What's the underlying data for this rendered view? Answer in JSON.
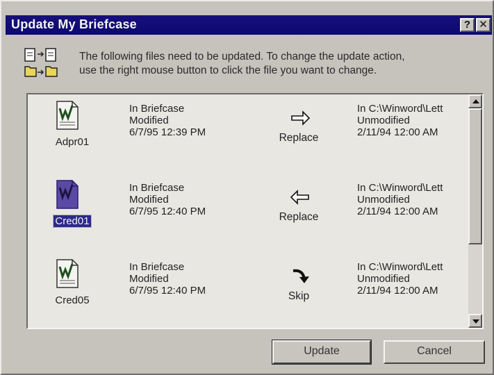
{
  "window": {
    "title": "Update My Briefcase",
    "help_label": "?",
    "close_label": "✕"
  },
  "instructions": {
    "line1": "The following files need to be updated. To change the update action,",
    "line2": "use the right mouse button to click the file you want to change."
  },
  "files": [
    {
      "name": "Adpr01",
      "briefcase": [
        "In Briefcase",
        "Modified",
        "6/7/95 12:39 PM"
      ],
      "action": "Replace",
      "action_icon": "arrow-right-icon",
      "destination": [
        "In C:\\Winword\\Lett",
        "Unmodified",
        "2/11/94 12:00 AM"
      ],
      "selected": false
    },
    {
      "name": "Cred01",
      "briefcase": [
        "In Briefcase",
        "Modified",
        "6/7/95 12:40 PM"
      ],
      "action": "Replace",
      "action_icon": "arrow-left-icon",
      "destination": [
        "In C:\\Winword\\Lett",
        "Unmodified",
        "2/11/94 12:00 AM"
      ],
      "selected": true
    },
    {
      "name": "Cred05",
      "briefcase": [
        "In Briefcase",
        "Modified",
        "6/7/95 12:40 PM"
      ],
      "action": "Skip",
      "action_icon": "skip-curved-arrow-icon",
      "destination": [
        "In C:\\Winword\\Lett",
        "Unmodified",
        "2/11/94 12:00 AM"
      ],
      "selected": false
    }
  ],
  "buttons": {
    "update": "Update",
    "cancel": "Cancel"
  },
  "colors": {
    "titlebar": "#0c0872",
    "selection": "#2d2a8a",
    "face": "#c6c3bd"
  }
}
